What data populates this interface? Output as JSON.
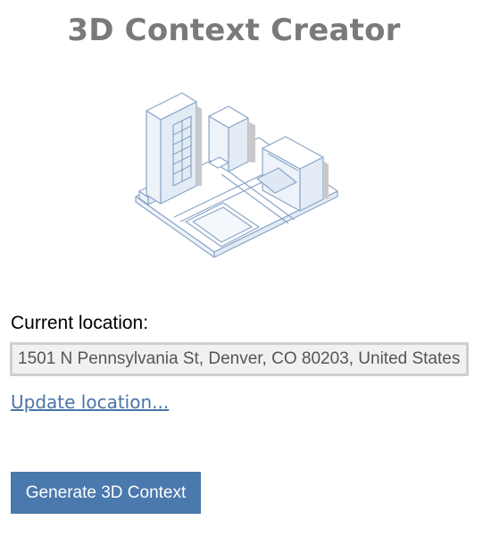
{
  "app": {
    "title": "3D Context Creator"
  },
  "location": {
    "label": "Current location:",
    "value": "1501 N Pennsylvania St, Denver, CO 80203, United States",
    "update_link": "Update location..."
  },
  "actions": {
    "generate_label": "Generate 3D Context"
  },
  "colors": {
    "title": "#7a7a7a",
    "link": "#4a74a7",
    "button": "#4a79ad",
    "illustration_stroke": "#8aa6c8"
  },
  "illustration": {
    "icon": "isometric-city-icon"
  }
}
